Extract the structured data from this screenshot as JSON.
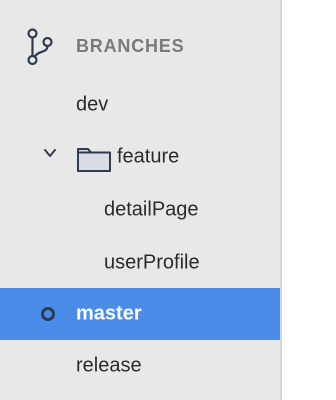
{
  "sidebar": {
    "section": {
      "title": "BRANCHES",
      "icon": "git-branch-icon"
    },
    "branches": [
      {
        "label": "dev",
        "type": "branch",
        "selected": false,
        "current": false
      },
      {
        "label": "feature",
        "type": "folder",
        "expanded": true,
        "icon": "folder-icon"
      },
      {
        "label": "detailPage",
        "type": "branch",
        "parent": "feature",
        "selected": false,
        "current": false
      },
      {
        "label": "userProfile",
        "type": "branch",
        "parent": "feature",
        "selected": false,
        "current": false
      },
      {
        "label": "master",
        "type": "branch",
        "selected": true,
        "current": true
      },
      {
        "label": "release",
        "type": "branch",
        "selected": false,
        "current": false
      }
    ]
  },
  "colors": {
    "sidebar_bg": "#e9e8e8",
    "selection": "#4b8ce9",
    "header_text": "#7a7a7a",
    "item_text": "#2b2b2b",
    "current_indicator": "#2f3b4e"
  }
}
